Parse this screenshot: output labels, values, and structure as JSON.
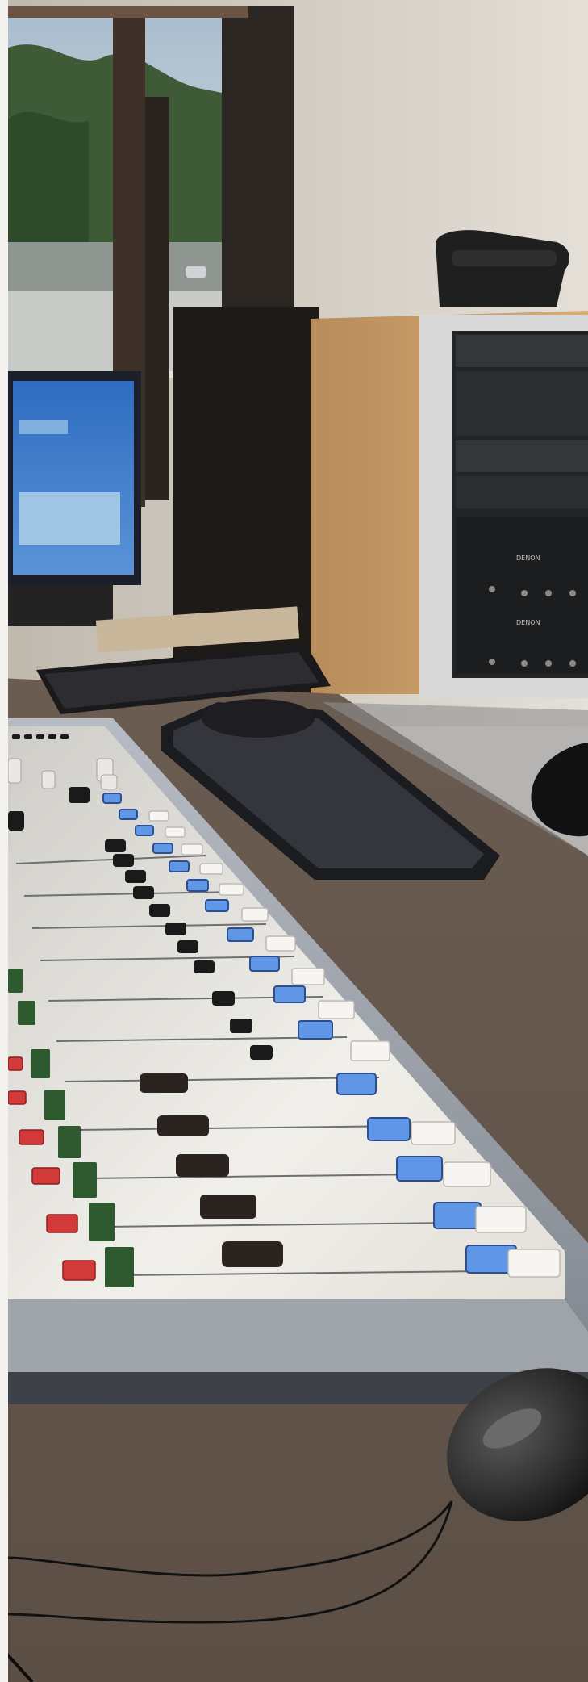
{
  "scene": {
    "description_tags": [
      "broadcast-studio",
      "mixing-console",
      "window",
      "keyboard",
      "mouse",
      "rack-equipment"
    ]
  },
  "rack": {
    "brand_top": "DENON",
    "brand_bottom": "DENON"
  },
  "colors": {
    "wall": "#d9d4cc",
    "desk": "#5a4e45",
    "console_surface": "#d8d6d0",
    "console_trim": "#9aa0a8",
    "rack_wood": "#caa06a",
    "red_button": "#d23a3a",
    "blue_button": "#5a8fe0",
    "monitor_screen": "#3a78c8"
  },
  "console": {
    "channel_count": 12
  }
}
